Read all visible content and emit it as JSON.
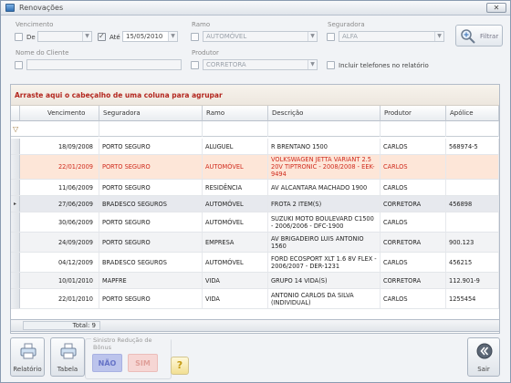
{
  "window": {
    "title": "Renovações",
    "close": "✕"
  },
  "filters": {
    "vencimento_label": "Vencimento",
    "de_label": "De",
    "de_value": "",
    "ate_label": "Até",
    "ate_value": "15/05/2010",
    "ramo_label": "Ramo",
    "ramo_value": "AUTOMÓVEL",
    "seguradora_label": "Seguradora",
    "seguradora_value": "ALFA",
    "nome_label": "Nome do Cliente",
    "nome_value": "",
    "produtor_label": "Produtor",
    "produtor_value": "CORRETORA",
    "incluir_label": "Incluir telefones no relatório",
    "filtrar_label": "Filtrar"
  },
  "grid": {
    "group_hint": "Arraste aqui o cabeçalho de uma coluna para agrupar",
    "columns": [
      "Vencimento",
      "Seguradora",
      "Ramo",
      "Descrição",
      "Produtor",
      "Apólice"
    ],
    "rows": [
      {
        "vencimento": "18/09/2008",
        "seguradora": "PORTO SEGURO",
        "ramo": "ALUGUEL",
        "descricao": "R BRENTANO 1500",
        "produtor": "CARLOS",
        "apolice": "568974-5"
      },
      {
        "vencimento": "22/01/2009",
        "seguradora": "PORTO SEGURO",
        "ramo": "AUTOMÓVEL",
        "descricao": "VOLKSWAGEN JETTA VARIANT 2.5 20V TIPTRONIC - 2008/2008 - EEK-9494",
        "produtor": "CARLOS",
        "apolice": ""
      },
      {
        "vencimento": "11/06/2009",
        "seguradora": "PORTO SEGURO",
        "ramo": "RESIDÊNCIA",
        "descricao": "AV ALCANTARA MACHADO 1900",
        "produtor": "CARLOS",
        "apolice": ""
      },
      {
        "vencimento": "27/06/2009",
        "seguradora": "BRADESCO SEGUROS",
        "ramo": "AUTOMÓVEL",
        "descricao": "FROTA 2 ITEM(S)",
        "produtor": "CORRETORA",
        "apolice": "456898"
      },
      {
        "vencimento": "30/06/2009",
        "seguradora": "PORTO SEGURO",
        "ramo": "AUTOMÓVEL",
        "descricao": "SUZUKI MOTO BOULEVARD C1500 - 2006/2006 - DFC-1900",
        "produtor": "CARLOS",
        "apolice": ""
      },
      {
        "vencimento": "24/09/2009",
        "seguradora": "PORTO SEGURO",
        "ramo": "EMPRESA",
        "descricao": "AV BRIGADEIRO LUIS ANTONIO 1560",
        "produtor": "CORRETORA",
        "apolice": "900.123"
      },
      {
        "vencimento": "04/12/2009",
        "seguradora": "BRADESCO SEGUROS",
        "ramo": "AUTOMÓVEL",
        "descricao": "FORD ECOSPORT XLT 1.6 8V FLEX - 2006/2007 - DER-1231",
        "produtor": "CARLOS",
        "apolice": "456215"
      },
      {
        "vencimento": "10/01/2010",
        "seguradora": "MAPFRE",
        "ramo": "VIDA",
        "descricao": "GRUPO 14 VIDA(S)",
        "produtor": "CORRETORA",
        "apolice": "112.901-9"
      },
      {
        "vencimento": "22/01/2010",
        "seguradora": "PORTO SEGURO",
        "ramo": "VIDA",
        "descricao": "ANTONIO CARLOS DA SILVA (INDIVIDUAL)",
        "produtor": "CARLOS",
        "apolice": "1255454"
      }
    ],
    "total_label": "Total: 9"
  },
  "actions": {
    "relatorio": "Relatório",
    "tabela": "Tabela",
    "bonus_group": "Sinistro Redução de Bônus",
    "nao": "NÃO",
    "sim": "SIM",
    "help": "?",
    "sair": "Sair"
  },
  "colors": {
    "group_text": "#b3261e",
    "selected_row_text": "#d02a1c",
    "selected_row_bg": "#fde6d8"
  }
}
